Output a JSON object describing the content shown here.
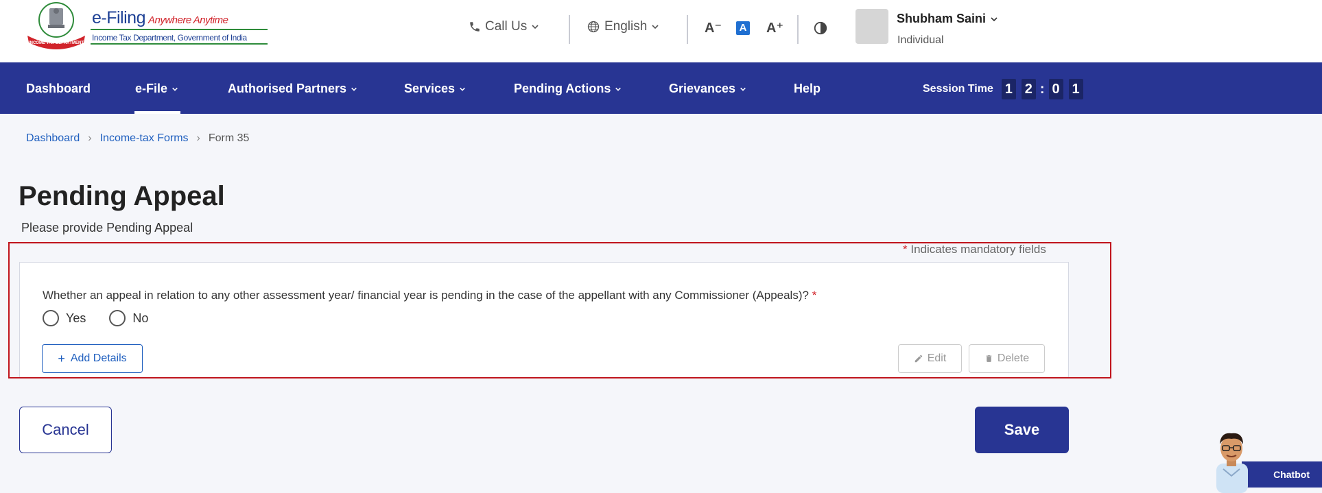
{
  "header": {
    "brand_main": "e-Filing",
    "brand_tagline": "Anywhere Anytime",
    "brand_sub": "Income Tax Department, Government of India",
    "emblem_text": "INCOME TAX DEPARTMENT",
    "call_us": "Call Us",
    "language": "English",
    "font_decrease": "A⁻",
    "font_default": "A",
    "font_increase": "A⁺",
    "user_name": "Shubham Saini",
    "user_role": "Individual"
  },
  "nav": {
    "items": [
      {
        "label": "Dashboard"
      },
      {
        "label": "e-File"
      },
      {
        "label": "Authorised Partners"
      },
      {
        "label": "Services"
      },
      {
        "label": "Pending Actions"
      },
      {
        "label": "Grievances"
      },
      {
        "label": "Help"
      }
    ],
    "session_label": "Session Time",
    "session_digits": [
      "1",
      "2",
      "0",
      "1"
    ]
  },
  "breadcrumb": {
    "items": [
      "Dashboard",
      "Income-tax Forms",
      "Form 35"
    ]
  },
  "page": {
    "title": "Pending Appeal",
    "subtitle": "Please provide Pending Appeal",
    "mandatory_star": "*",
    "mandatory_note": "Indicates mandatory fields"
  },
  "form": {
    "question": "Whether an appeal in relation to any other assessment year/ financial year is pending in the case of the appellant with any Commissioner (Appeals)?",
    "question_star": "*",
    "options": [
      "Yes",
      "No"
    ],
    "selected": null,
    "add_details_label": "Add Details",
    "edit_label": "Edit",
    "delete_label": "Delete"
  },
  "actions": {
    "cancel_label": "Cancel",
    "save_label": "Save"
  },
  "chatbot": {
    "label": "Chatbot"
  },
  "colors": {
    "primary": "#283593",
    "link": "#1f5fbf",
    "required": "#d1232a",
    "highlight_border": "#c0141c"
  }
}
